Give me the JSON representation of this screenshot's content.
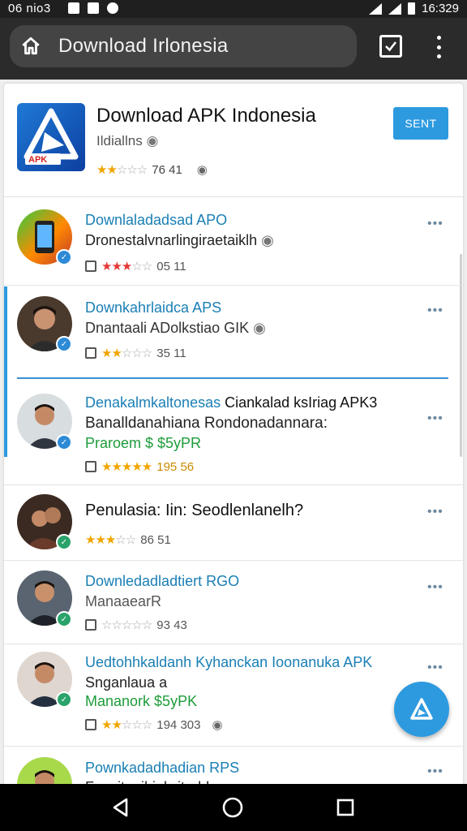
{
  "status_bar": {
    "time_left": "06 nio3",
    "time_right": "16:329"
  },
  "browser": {
    "url_text": "Download  Irlonesia"
  },
  "featured": {
    "title": "Download APK Indonesia",
    "subtitle": "Ildiallns",
    "rating_text": "76  41",
    "install_label": "SENT",
    "logo_text": "APK",
    "stars_filled": 2.5
  },
  "rows": [
    {
      "title": "Downlaladadsad APO",
      "line1": "Dronestalvnarlingiraetaiklh",
      "rating_text": "05  11",
      "stars_filled": 3
    },
    {
      "title": "Downkahrlaidca APS",
      "line1": "Dnantaali ADolkstiao GIK",
      "rating_text": "35  11",
      "stars_filled": 2.5
    },
    {
      "title": "Denakalmkaltonesas",
      "title_dark": "Ciankalad ksIriag APK3",
      "line1": "Banalldanahiana Rondonadannara:",
      "line2": "Praroem $ $5yPR",
      "rating_text": "195  56",
      "stars_filled": 4.5
    },
    {
      "title_dark": "Penulasia: Iin: Seodlenlanelh?",
      "rating_text": "86  51",
      "stars_filled": 3
    },
    {
      "title": "Downledadladtiert RGO",
      "line1": "ManaaearR",
      "rating_text": "93  43",
      "stars_filled": 0
    },
    {
      "title": "Uedtohhkaldanh Kyhanckan Ioonanuka APK",
      "line1": "Snganlaua a",
      "line2": "Mananork $5yPK",
      "rating_text": "194 303",
      "stars_filled": 2.5
    },
    {
      "title": "Pownkadadhadian RPS",
      "line1": "Fensitanihinlwitadd"
    }
  ]
}
